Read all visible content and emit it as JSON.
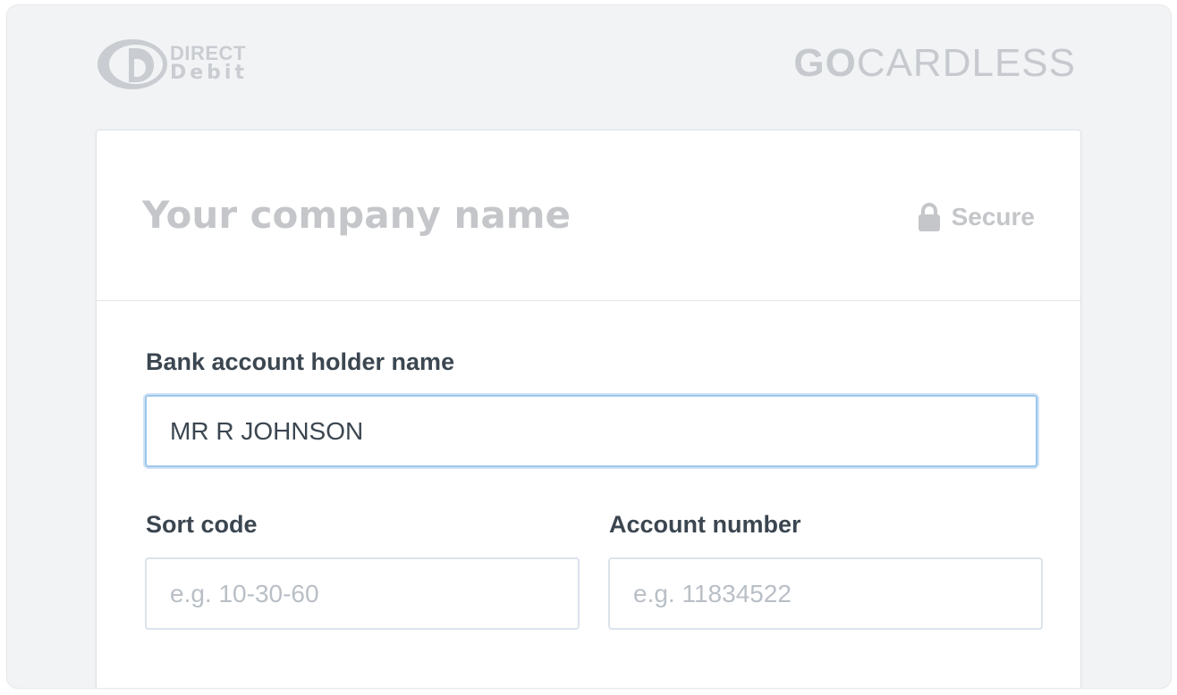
{
  "header": {
    "direct_debit_line1": "DIRECT",
    "direct_debit_line2": "Debit",
    "gocardless_go": "GO",
    "gocardless_cardless": "CARDLESS"
  },
  "card": {
    "company_name": "Your company name",
    "secure_label": "Secure",
    "secure_icon": "lock-icon"
  },
  "form": {
    "holder": {
      "label": "Bank account holder name",
      "value": "MR R JOHNSON",
      "placeholder": ""
    },
    "sort_code": {
      "label": "Sort code",
      "value": "",
      "placeholder": "e.g. 10-30-60"
    },
    "account_number": {
      "label": "Account number",
      "value": "",
      "placeholder": "e.g. 11834522"
    }
  },
  "colors": {
    "background": "#f2f3f5",
    "logo_gray": "#c6c9ce",
    "label_text": "#3b4650",
    "focus_border": "#9cc6ea"
  }
}
